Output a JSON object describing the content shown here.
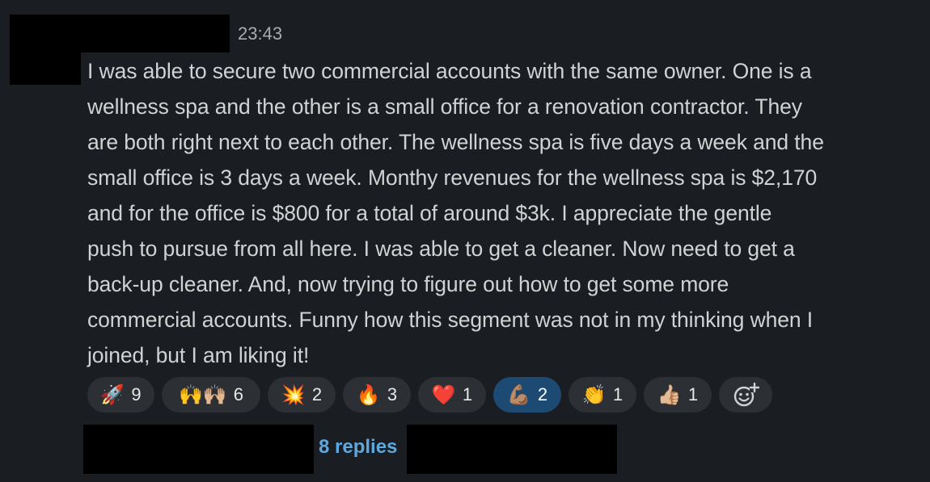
{
  "message": {
    "timestamp": "23:43",
    "lines": [
      "I was able to secure two commercial accounts with the same owner.  One is a",
      "wellness spa and the other is a small office for a renovation contractor.  They",
      "are both right next to each other.  The wellness spa is five days a week and the",
      "small office is 3 days a week.  Monthy revenues for the wellness spa is $2,170",
      "and for the office is $800 for a total of around $3k.  I appreciate the gentle",
      "push to pursue from all here.   I was able to get a cleaner.  Now need to get a",
      "back-up cleaner.  And, now trying to figure out how to get some more",
      "commercial accounts.  Funny how this segment was not in my thinking when I",
      "joined, but I am liking it!"
    ]
  },
  "reactions": [
    {
      "emoji": "🚀",
      "icon": "rocket-icon",
      "count": "9",
      "active": false
    },
    {
      "emoji": "🙌🙌🏼",
      "icon": "raised-hands-icon",
      "count": "6",
      "active": false
    },
    {
      "emoji": "💥",
      "icon": "collision-icon",
      "count": "2",
      "active": false
    },
    {
      "emoji": "🔥",
      "icon": "fire-icon",
      "count": "3",
      "active": false
    },
    {
      "emoji": "❤️",
      "icon": "heart-icon",
      "count": "1",
      "active": false
    },
    {
      "emoji": "💪🏽",
      "icon": "flexed-biceps-icon",
      "count": "2",
      "active": true
    },
    {
      "emoji": "👏",
      "icon": "clapping-hands-icon",
      "count": "1",
      "active": false
    },
    {
      "emoji": "👍🏼",
      "icon": "thumbs-up-icon",
      "count": "1",
      "active": false
    }
  ],
  "add_reaction_icon": "add-reaction-icon",
  "thread": {
    "replies_label": "8 replies"
  },
  "colors": {
    "background": "#1a1d21",
    "text": "#d1d2d3",
    "link": "#5ea8e0",
    "reaction_active": "#1d4a73",
    "reaction_bg": "#2c2f33"
  }
}
